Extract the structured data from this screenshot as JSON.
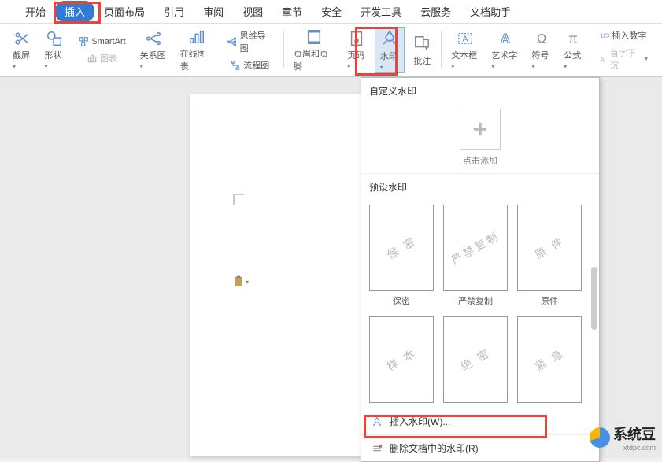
{
  "tabs": {
    "start": "开始",
    "insert": "插入",
    "layout": "页面布局",
    "ref": "引用",
    "review": "审阅",
    "view": "视图",
    "chapter": "章节",
    "safe": "安全",
    "dev": "开发工具",
    "cloud": "云服务",
    "helper": "文档助手"
  },
  "ribbon": {
    "screenshot": "截屏",
    "shape": "形状",
    "smartart": "SmartArt",
    "chart": "图表",
    "relate": "关系图",
    "onlinechart": "在线图表",
    "mindmap": "思维导图",
    "flowchart": "流程图",
    "headerfooter": "页眉和页脚",
    "pagenum": "页码",
    "watermark": "水印",
    "comment": "批注",
    "textbox": "文本框",
    "wordart": "艺术字",
    "symbol": "符号",
    "equation": "公式",
    "insertnum": "插入数字",
    "dropcap": "首字下沉"
  },
  "dropdown": {
    "custom": "自定义水印",
    "click_add": "点击添加",
    "preset": "预设水印",
    "p1": "保 密",
    "p1l": "保密",
    "p2": "严禁复制",
    "p2l": "严禁复制",
    "p3": "原 件",
    "p3l": "原件",
    "p4": "样 本",
    "p5": "绝 密",
    "p6": "紧 急",
    "insert": "插入水印(W)...",
    "remove": "删除文档中的水印(R)"
  },
  "brand": {
    "name": "系统豆",
    "url": "xtdpc.com"
  }
}
